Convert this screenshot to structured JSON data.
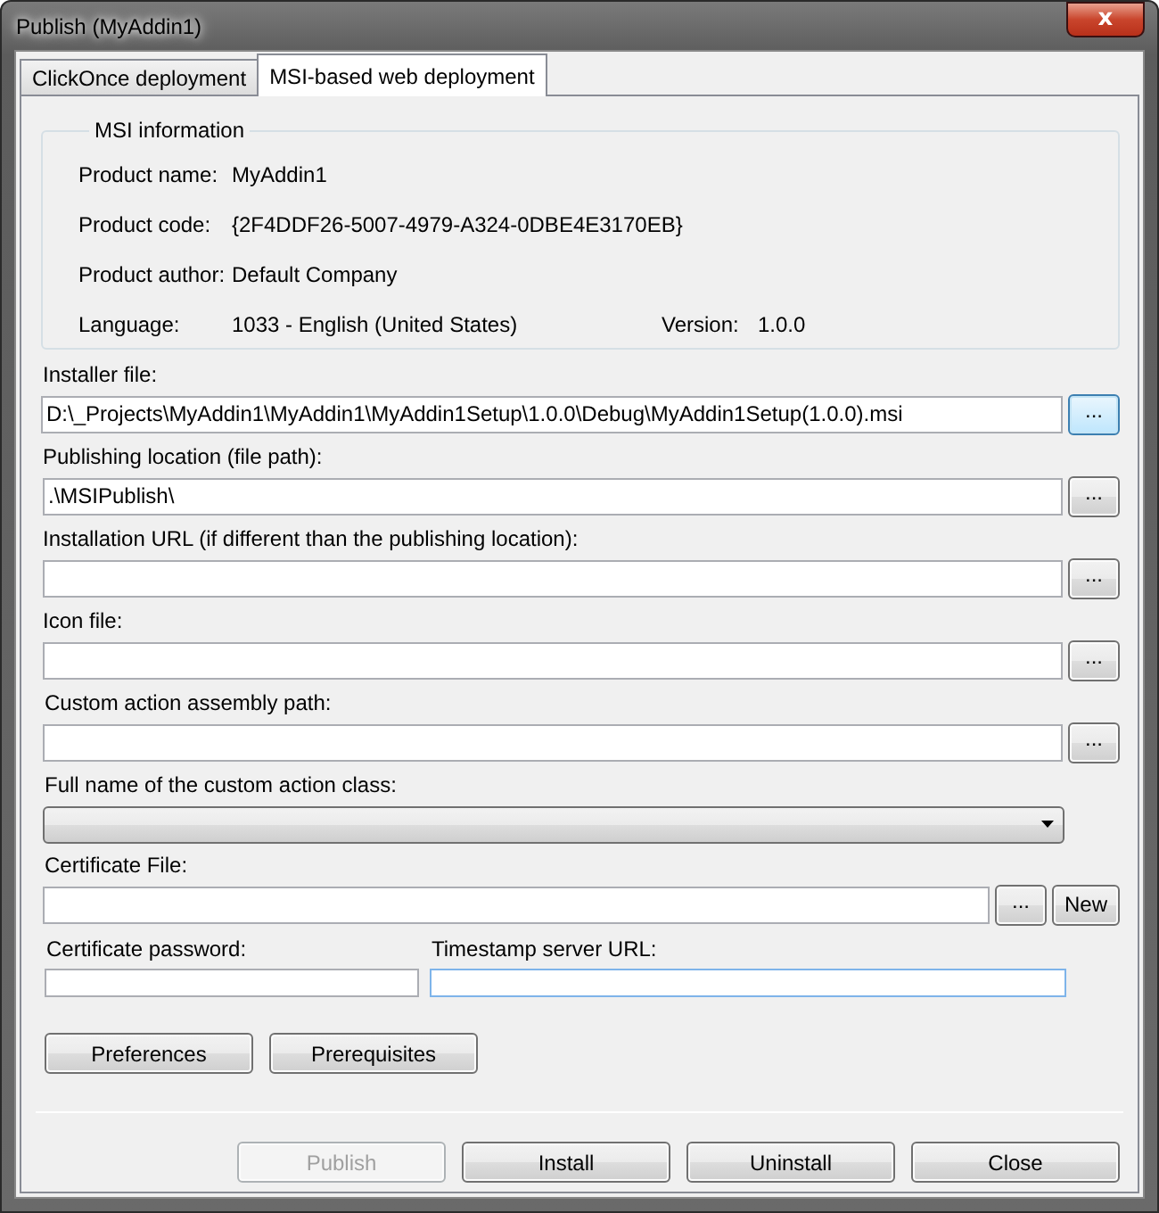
{
  "window": {
    "title": "Publish (MyAddin1)",
    "close_label": "x"
  },
  "tabs": [
    {
      "label": "ClickOnce deployment",
      "selected": false
    },
    {
      "label": "MSI-based web deployment",
      "selected": true
    }
  ],
  "msi_information": {
    "title": "MSI information",
    "rows": [
      {
        "label": "Product name:",
        "value": "MyAddin1"
      },
      {
        "label": "Product code:",
        "value": "{2F4DDF26-5007-4979-A324-0DBE4E3170EB}"
      },
      {
        "label": "Product author:",
        "value": "Default Company"
      },
      {
        "label": "Language:",
        "value": "1033 - English (United States)",
        "extra_label": "Version:",
        "extra_value": "1.0.0"
      }
    ]
  },
  "path_fields": [
    {
      "label": "Installer file:",
      "value": "D:\\_Projects\\MyAddin1\\MyAddin1\\MyAddin1Setup\\1.0.0\\Debug\\MyAddin1Setup(1.0.0).msi",
      "browse": "...",
      "browse_highlighted": true
    },
    {
      "label": "Publishing location (file path):",
      "value": ".\\MSIPublish\\",
      "browse": "...",
      "browse_highlighted": false
    },
    {
      "label": "Installation URL (if different than the publishing location):",
      "browse": "...",
      "browse_highlighted": false
    },
    {
      "label": "Icon file:",
      "browse": "...",
      "browse_highlighted": false
    },
    {
      "label": "Custom action assembly path:",
      "browse": "...",
      "browse_highlighted": false
    }
  ],
  "custom_action_class": {
    "label": "Full name of the custom action class:"
  },
  "certificate_file": {
    "label": "Certificate File:",
    "browse": "...",
    "new": "New"
  },
  "small_fields": [
    {
      "label": "Certificate password:",
      "focused": false
    },
    {
      "label": "Timestamp server URL:",
      "focused": true
    }
  ],
  "option_buttons": [
    "Preferences",
    "Prerequisites"
  ],
  "footer_buttons": [
    {
      "label": "Publish",
      "disabled": true
    },
    {
      "label": "Install",
      "disabled": false
    },
    {
      "label": "Uninstall",
      "disabled": false
    },
    {
      "label": "Close",
      "disabled": false
    }
  ]
}
